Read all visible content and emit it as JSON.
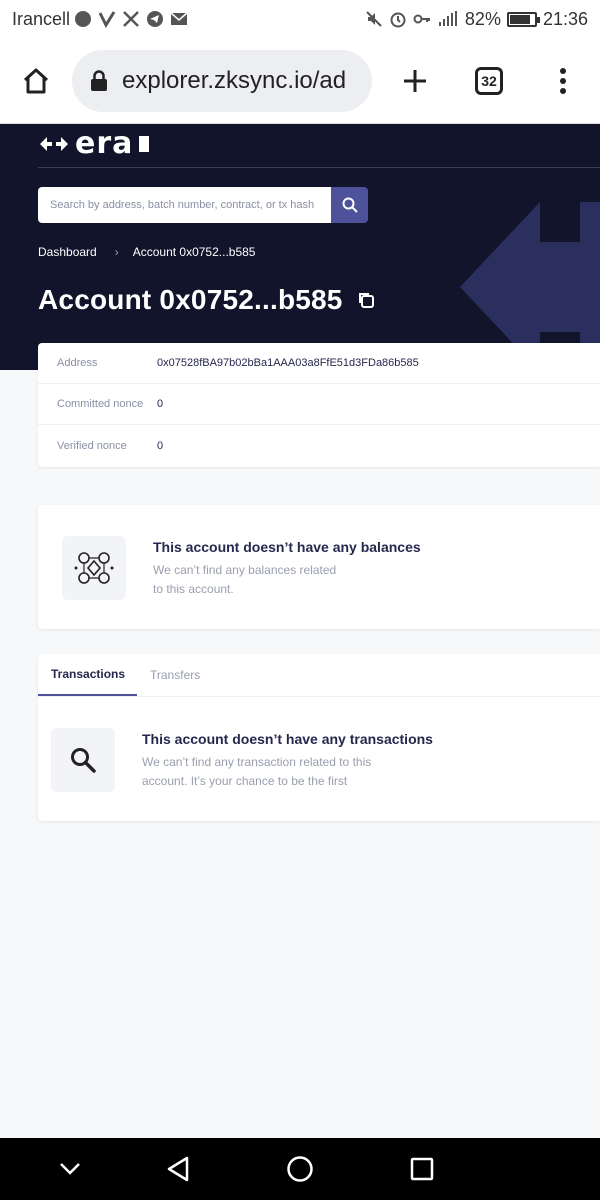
{
  "status_bar": {
    "carrier": "Irancell",
    "battery": "82%",
    "battery_level": 0.82,
    "time": "21:36"
  },
  "browser": {
    "url": "explorer.zksync.io/ad",
    "tab_count": "32"
  },
  "header": {
    "logo_text": "era",
    "search_placeholder": "Search by address, batch number, contract, or tx hash"
  },
  "breadcrumb": {
    "root": "Dashboard",
    "current": "Account 0x0752...b585"
  },
  "page": {
    "title": "Account 0x0752...b585"
  },
  "account_info": {
    "rows": [
      {
        "label": "Address",
        "value": "0x07528fBA97b02bBa1AAA03a8FfE51d3FDa86b585"
      },
      {
        "label": "Committed nonce",
        "value": "0"
      },
      {
        "label": "Verified nonce",
        "value": "0"
      }
    ]
  },
  "balances": {
    "title": "This account doesn’t have any balances",
    "desc_line1": "We can’t find any balances related",
    "desc_line2": "to this account."
  },
  "tabs": {
    "transactions": "Transactions",
    "transfers": "Transfers"
  },
  "transactions_empty": {
    "title": "This account doesn’t have any transactions",
    "desc_line1": "We can’t find any transaction related to this",
    "desc_line2": "account. It’s your chance to be the first"
  },
  "colors": {
    "header_bg": "#11142b",
    "accent": "#4e529a",
    "page_bg": "#f7f8fa"
  }
}
